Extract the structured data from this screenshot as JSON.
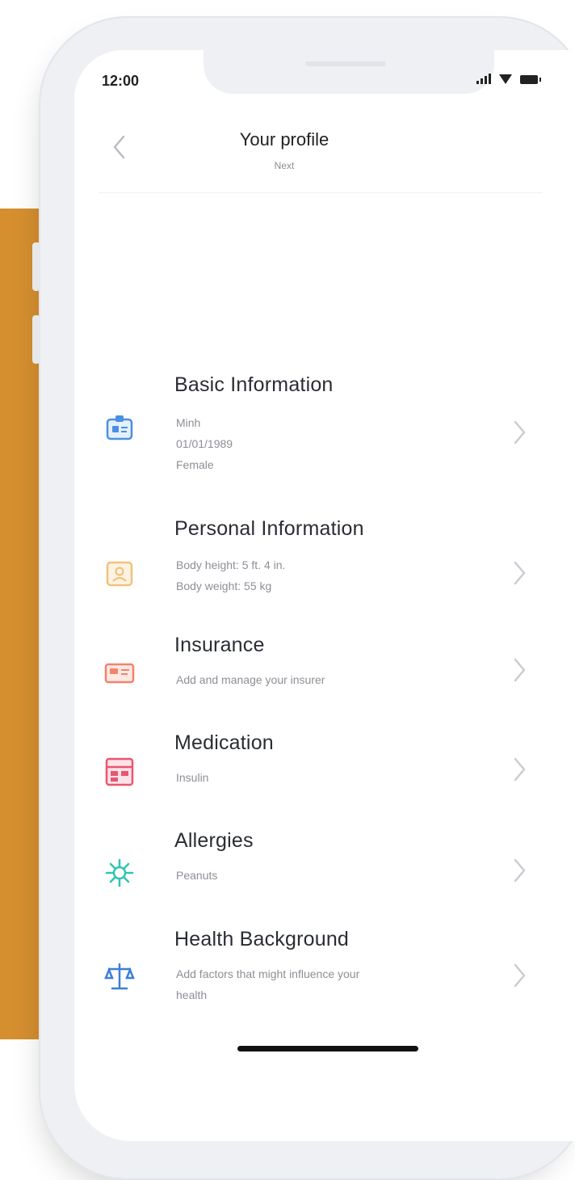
{
  "status_bar": {
    "time": "12:00"
  },
  "header": {
    "back_icon": "chevron-left-icon",
    "title": "Your profile",
    "subtitle": "Next"
  },
  "items": [
    {
      "icon": "id-card-icon",
      "icon_color": "#4a90e2",
      "title": "Basic Information",
      "lines": [
        "Minh",
        "01/01/1989",
        "Female"
      ]
    },
    {
      "icon": "profile-card-icon",
      "icon_color": "#f2c27a",
      "title": "Personal Information",
      "lines": [
        "Body height: 5 ft. 4 in.",
        "Body weight: 55 kg"
      ]
    },
    {
      "icon": "insurance-card-icon",
      "icon_color": "#f2836b",
      "title": "Insurance",
      "lines": [
        "Add and manage your insurer"
      ]
    },
    {
      "icon": "medication-icon",
      "icon_color": "#e8566f",
      "title": "Medication",
      "lines": [
        "Insulin"
      ]
    },
    {
      "icon": "allergy-icon",
      "icon_color": "#2fc4b2",
      "title": "Allergies",
      "lines": [
        "Peanuts"
      ]
    },
    {
      "icon": "scale-icon",
      "icon_color": "#3b7ed8",
      "title": "Health Background",
      "lines": [
        "Add factors that might influence your",
        "health"
      ]
    }
  ],
  "colors": {
    "accent_panel": "#d58f2f",
    "chevron": "#c9ccd1"
  }
}
